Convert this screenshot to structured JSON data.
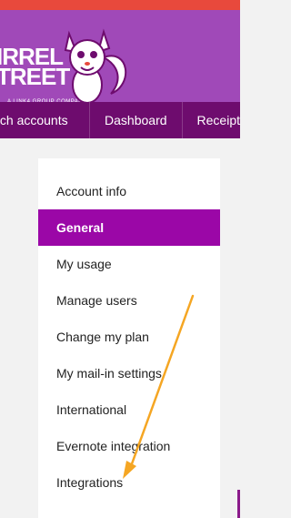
{
  "logo": {
    "line1": "IRREL",
    "line2": "TREET",
    "tagline": "A LINK4 GROUP COMPANY"
  },
  "nav": {
    "items": [
      "tch accounts",
      "Dashboard",
      "Receipt"
    ]
  },
  "sidebar": {
    "title": "Account info",
    "items": [
      {
        "label": "General",
        "active": true
      },
      {
        "label": "My usage"
      },
      {
        "label": "Manage users"
      },
      {
        "label": "Change my plan"
      },
      {
        "label": "My mail-in settings"
      },
      {
        "label": "International"
      },
      {
        "label": "Evernote integration"
      },
      {
        "label": "Integrations"
      }
    ]
  },
  "colors": {
    "header": "#a049b8",
    "nav": "#6e0c6e",
    "active": "#9b07a7",
    "arrow": "#f5a623"
  }
}
